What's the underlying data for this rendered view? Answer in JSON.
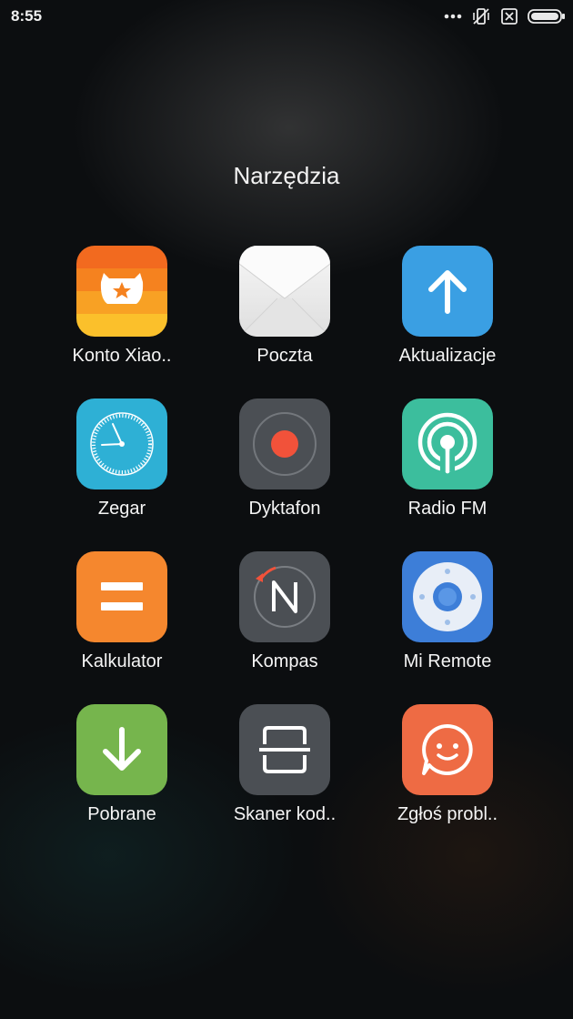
{
  "status_bar": {
    "time": "8:55",
    "icons": [
      "more-dots-icon",
      "vibrate-off-icon",
      "no-sim-icon",
      "battery-icon"
    ]
  },
  "folder": {
    "title": "Narzędzia",
    "apps": [
      {
        "label": "Konto Xiao..",
        "icon": "mi-account-icon",
        "color": "#f07a22"
      },
      {
        "label": "Poczta",
        "icon": "mail-envelope-icon",
        "color": "#ececec"
      },
      {
        "label": "Aktualizacje",
        "icon": "arrow-up-icon",
        "color": "#3aa0e4"
      },
      {
        "label": "Zegar",
        "icon": "clock-icon",
        "color": "#2fb1d6"
      },
      {
        "label": "Dyktafon",
        "icon": "record-icon",
        "color": "#4c5055"
      },
      {
        "label": "Radio FM",
        "icon": "radio-antenna-icon",
        "color": "#3dbf9e"
      },
      {
        "label": "Kalkulator",
        "icon": "equals-icon",
        "color": "#f5872e"
      },
      {
        "label": "Kompas",
        "icon": "compass-icon",
        "color": "#4c5055"
      },
      {
        "label": "Mi Remote",
        "icon": "remote-dpad-icon",
        "color": "#3e7fd8"
      },
      {
        "label": "Pobrane",
        "icon": "arrow-down-icon",
        "color": "#77b64e"
      },
      {
        "label": "Skaner kod..",
        "icon": "scanner-icon",
        "color": "#4c5055"
      },
      {
        "label": "Zgłoś probl..",
        "icon": "feedback-smile-icon",
        "color": "#ee6c45"
      }
    ]
  }
}
